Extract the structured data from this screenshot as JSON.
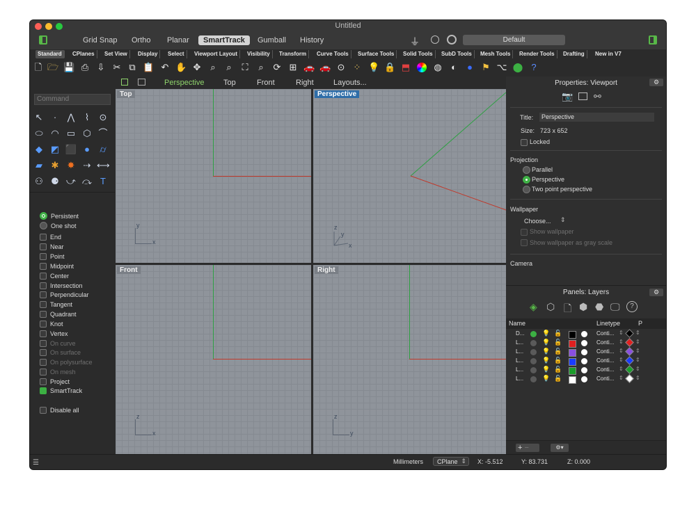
{
  "window": {
    "title": "Untitled",
    "traffic_colors": [
      "#fe5f57",
      "#febb2e",
      "#28c840"
    ]
  },
  "modebar": {
    "items": [
      "Grid Snap",
      "Ortho",
      "Planar",
      "SmartTrack",
      "Gumball",
      "History"
    ],
    "active": "SmartTrack",
    "display_mode": "Default"
  },
  "tabs": [
    "Standard",
    "CPlanes",
    "Set View",
    "Display",
    "Select",
    "Viewport Layout",
    "Visibility",
    "Transform",
    "Curve Tools",
    "Surface Tools",
    "Solid Tools",
    "SubD Tools",
    "Mesh Tools",
    "Render Tools",
    "Drafting",
    "New in V7"
  ],
  "active_tab": "Standard",
  "toolbar_icons": [
    "new-file",
    "open-file",
    "save",
    "print",
    "import",
    "cut",
    "copy",
    "paste",
    "undo",
    "pan",
    "rotate-view",
    "zoom",
    "zoom-window",
    "zoom-extents",
    "zoom-selected",
    "rotate",
    "four-viewports",
    "shade",
    "render-preview",
    "ghosted",
    "osnap",
    "snap-grid",
    "light",
    "lock",
    "cplane",
    "color-wheel",
    "material",
    "environment",
    "render",
    "bulb",
    "history",
    "properties",
    "help"
  ],
  "command": {
    "placeholder": "Command"
  },
  "osnaps": {
    "persistent": "Persistent",
    "one_shot": "One shot",
    "items": [
      {
        "label": "End",
        "enabled": true,
        "checked": false
      },
      {
        "label": "Near",
        "enabled": true,
        "checked": false
      },
      {
        "label": "Point",
        "enabled": true,
        "checked": false
      },
      {
        "label": "Midpoint",
        "enabled": true,
        "checked": false
      },
      {
        "label": "Center",
        "enabled": true,
        "checked": false
      },
      {
        "label": "Intersection",
        "enabled": true,
        "checked": false
      },
      {
        "label": "Perpendicular",
        "enabled": true,
        "checked": false
      },
      {
        "label": "Tangent",
        "enabled": true,
        "checked": false
      },
      {
        "label": "Quadrant",
        "enabled": true,
        "checked": false
      },
      {
        "label": "Knot",
        "enabled": true,
        "checked": false
      },
      {
        "label": "Vertex",
        "enabled": true,
        "checked": false
      },
      {
        "label": "On curve",
        "enabled": false,
        "checked": false
      },
      {
        "label": "On surface",
        "enabled": false,
        "checked": false
      },
      {
        "label": "On polysurface",
        "enabled": false,
        "checked": false
      },
      {
        "label": "On mesh",
        "enabled": false,
        "checked": false
      },
      {
        "label": "Project",
        "enabled": true,
        "checked": false
      },
      {
        "label": "SmartTrack",
        "enabled": true,
        "checked": true
      }
    ],
    "disable_all": "Disable all"
  },
  "viewport_tabs": [
    "Perspective",
    "Top",
    "Front",
    "Right",
    "Layouts..."
  ],
  "active_viewport_tab": "Perspective",
  "viewports": {
    "top": {
      "label": "Top",
      "axis1": "x",
      "axis2": "y"
    },
    "perspective": {
      "label": "Perspective",
      "axis1": "x",
      "axis2": "y",
      "axis3": "z"
    },
    "front": {
      "label": "Front",
      "axis1": "x",
      "axis2": "z"
    },
    "right": {
      "label": "Right",
      "axis1": "y",
      "axis2": "z"
    }
  },
  "properties": {
    "header": "Properties: Viewport",
    "title_label": "Title:",
    "title_value": "Perspective",
    "size_label": "Size:",
    "size_value": "723 x 652",
    "locked": "Locked",
    "projection_header": "Projection",
    "projection_options": [
      "Parallel",
      "Perspective",
      "Two point perspective"
    ],
    "projection_selected": "Perspective",
    "wallpaper_header": "Wallpaper",
    "wallpaper_choose": "Choose...",
    "show_wallpaper": "Show wallpaper",
    "show_wallpaper_gray": "Show wallpaper as gray scale",
    "camera_header": "Camera"
  },
  "layers": {
    "header": "Panels: Layers",
    "col_name": "Name",
    "col_linetype": "Linetype",
    "col_print": "P",
    "rows": [
      {
        "name": "D...",
        "current": true,
        "color": "#000000",
        "linetype": "Conti..."
      },
      {
        "name": "L...",
        "current": false,
        "color": "#e02020",
        "linetype": "Conti..."
      },
      {
        "name": "L...",
        "current": false,
        "color": "#8a4fe0",
        "linetype": "Conti..."
      },
      {
        "name": "L...",
        "current": false,
        "color": "#1a3cff",
        "linetype": "Conti..."
      },
      {
        "name": "L...",
        "current": false,
        "color": "#1a9c2a",
        "linetype": "Conti..."
      },
      {
        "name": "L...",
        "current": false,
        "color": "#ffffff",
        "linetype": "Conti..."
      }
    ]
  },
  "status": {
    "units": "Millimeters",
    "cplane": "CPlane",
    "x": "X: -5.512",
    "y": "Y: 83.731",
    "z": "Z: 0.000"
  }
}
